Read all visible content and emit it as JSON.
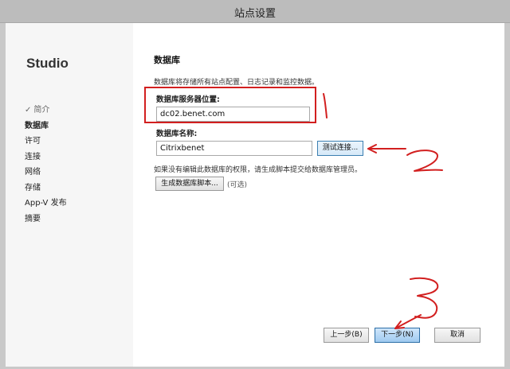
{
  "window": {
    "title": "站点设置"
  },
  "sidebar": {
    "brand": "Studio",
    "check_mark": "✓",
    "items": [
      {
        "label": "简介",
        "state": "done"
      },
      {
        "label": "数据库",
        "state": "active"
      },
      {
        "label": "许可",
        "state": "normal"
      },
      {
        "label": "连接",
        "state": "normal"
      },
      {
        "label": "网络",
        "state": "normal"
      },
      {
        "label": "存储",
        "state": "normal"
      },
      {
        "label": "App-V 发布",
        "state": "normal"
      },
      {
        "label": "摘要",
        "state": "normal"
      }
    ]
  },
  "main": {
    "heading": "数据库",
    "description": "数据库将存储所有站点配置、日志记录和监控数据。",
    "server_label": "数据库服务器位置:",
    "server_value": "dc02.benet.com",
    "dbname_label": "数据库名称:",
    "dbname_value": "Citrixbenet",
    "test_button": "测试连接...",
    "hint": "如果没有编辑此数据库的权限，请生成脚本提交给数据库管理员。",
    "generate_button": "生成数据库脚本...",
    "optional": "(可选)"
  },
  "footer": {
    "back_button": "上一步(B)",
    "next_button": "下一步(N)",
    "cancel_button": "取消"
  },
  "annotations": {
    "color": "#d21f1f",
    "marks": [
      "1",
      "2",
      "3"
    ]
  }
}
